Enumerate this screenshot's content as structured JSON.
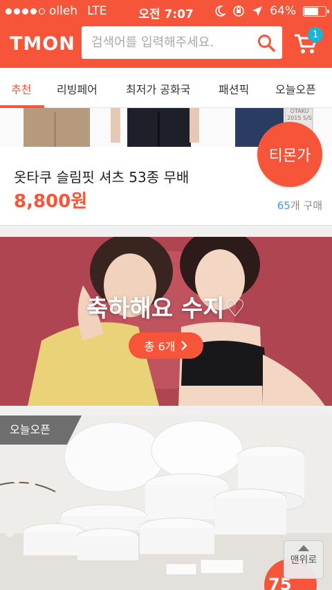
{
  "status": {
    "carrier": "olleh",
    "network": "LTE",
    "time": "오전 7:07",
    "battery": "64%",
    "battery_level": 0.64
  },
  "header": {
    "logo": "TMON",
    "search_placeholder": "검색어를 입력해주세요.",
    "cart_count": "1"
  },
  "tabs": [
    "추천",
    "리빙페어",
    "최저가 공화국",
    "패션픽",
    "오늘오픈"
  ],
  "product": {
    "image_text_line1": "OTAKU",
    "image_text_line2": "2015 S/S",
    "title": "옷타쿠 슬림핏 셔츠 53종 무배",
    "price": "8,800원",
    "sold_count": "65",
    "sold_suffix": "개 구매",
    "badge": "티몬가"
  },
  "banner": {
    "title": "축하해요 수지♡",
    "button": "총 6개"
  },
  "open_section": {
    "tag": "오늘오픈",
    "discount_fragment": "75"
  },
  "top_button": "맨위로",
  "colors": {
    "brand": "#f6553a",
    "badge_blue": "#19b5d8",
    "sold_blue": "#3a9ed9"
  }
}
